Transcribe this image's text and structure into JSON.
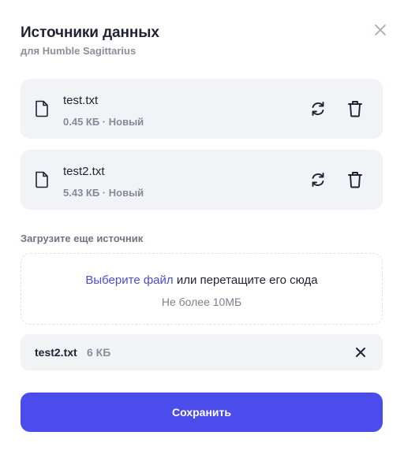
{
  "modal": {
    "title": "Источники данных",
    "subtitle": "для Humble Sagittarius",
    "close_icon": "close-icon"
  },
  "sources": [
    {
      "name": "test.txt",
      "meta": "0.45 КБ · Новый",
      "icons": [
        "file-icon",
        "refresh-icon",
        "trash-icon"
      ]
    },
    {
      "name": "test2.txt",
      "meta": "5.43 КБ · Новый",
      "icons": [
        "file-icon",
        "refresh-icon",
        "trash-icon"
      ]
    }
  ],
  "upload": {
    "label": "Загрузите еще источник",
    "link_text": "Выберите файл",
    "drop_text": " или перетащите его сюда",
    "limit_text": "Не более 10МБ"
  },
  "pending_file": {
    "name": "test2.txt",
    "size": "6 КБ",
    "remove_icon": "close-icon"
  },
  "footer": {
    "save_label": "Сохранить"
  },
  "colors": {
    "accent": "#4a4ceb",
    "link": "#4a4bd6",
    "card_bg": "#f2f3f6",
    "title": "#1e2233",
    "muted": "#8a8f9c"
  }
}
